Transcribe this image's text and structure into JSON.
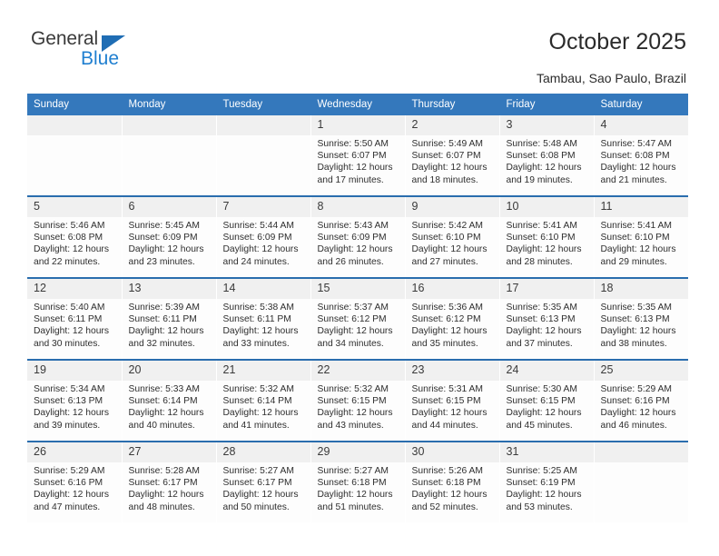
{
  "brand": {
    "name_top": "General",
    "name_bottom": "Blue",
    "logo_icon": "blue-triangle-icon",
    "accent_color": "#1f7fd0"
  },
  "header": {
    "title": "October 2025",
    "subtitle": "Tambau, Sao Paulo, Brazil"
  },
  "theme": {
    "header_row_bg": "#3478bc",
    "week_divider": "#2a6dae",
    "daynum_bg": "#f0f0f0",
    "text": "#2e2e2e"
  },
  "calendar": {
    "columns": [
      "Sunday",
      "Monday",
      "Tuesday",
      "Wednesday",
      "Thursday",
      "Friday",
      "Saturday"
    ],
    "labels": {
      "sunrise": "Sunrise:",
      "sunset": "Sunset:",
      "daylight": "Daylight:"
    },
    "weeks": [
      [
        {
          "day": "",
          "empty": true
        },
        {
          "day": "",
          "empty": true
        },
        {
          "day": "",
          "empty": true
        },
        {
          "day": "1",
          "sunrise": "5:50 AM",
          "sunset": "6:07 PM",
          "daylight": "12 hours and 17 minutes.",
          "line1": "Sunrise: 5:50 AM",
          "line2": "Sunset: 6:07 PM",
          "line3": "Daylight: 12 hours and 17 minutes."
        },
        {
          "day": "2",
          "sunrise": "5:49 AM",
          "sunset": "6:07 PM",
          "daylight": "12 hours and 18 minutes.",
          "line1": "Sunrise: 5:49 AM",
          "line2": "Sunset: 6:07 PM",
          "line3": "Daylight: 12 hours and 18 minutes."
        },
        {
          "day": "3",
          "sunrise": "5:48 AM",
          "sunset": "6:08 PM",
          "daylight": "12 hours and 19 minutes.",
          "line1": "Sunrise: 5:48 AM",
          "line2": "Sunset: 6:08 PM",
          "line3": "Daylight: 12 hours and 19 minutes."
        },
        {
          "day": "4",
          "sunrise": "5:47 AM",
          "sunset": "6:08 PM",
          "daylight": "12 hours and 21 minutes.",
          "line1": "Sunrise: 5:47 AM",
          "line2": "Sunset: 6:08 PM",
          "line3": "Daylight: 12 hours and 21 minutes."
        }
      ],
      [
        {
          "day": "5",
          "sunrise": "5:46 AM",
          "sunset": "6:08 PM",
          "daylight": "12 hours and 22 minutes.",
          "line1": "Sunrise: 5:46 AM",
          "line2": "Sunset: 6:08 PM",
          "line3": "Daylight: 12 hours and 22 minutes."
        },
        {
          "day": "6",
          "sunrise": "5:45 AM",
          "sunset": "6:09 PM",
          "daylight": "12 hours and 23 minutes.",
          "line1": "Sunrise: 5:45 AM",
          "line2": "Sunset: 6:09 PM",
          "line3": "Daylight: 12 hours and 23 minutes."
        },
        {
          "day": "7",
          "sunrise": "5:44 AM",
          "sunset": "6:09 PM",
          "daylight": "12 hours and 24 minutes.",
          "line1": "Sunrise: 5:44 AM",
          "line2": "Sunset: 6:09 PM",
          "line3": "Daylight: 12 hours and 24 minutes."
        },
        {
          "day": "8",
          "sunrise": "5:43 AM",
          "sunset": "6:09 PM",
          "daylight": "12 hours and 26 minutes.",
          "line1": "Sunrise: 5:43 AM",
          "line2": "Sunset: 6:09 PM",
          "line3": "Daylight: 12 hours and 26 minutes."
        },
        {
          "day": "9",
          "sunrise": "5:42 AM",
          "sunset": "6:10 PM",
          "daylight": "12 hours and 27 minutes.",
          "line1": "Sunrise: 5:42 AM",
          "line2": "Sunset: 6:10 PM",
          "line3": "Daylight: 12 hours and 27 minutes."
        },
        {
          "day": "10",
          "sunrise": "5:41 AM",
          "sunset": "6:10 PM",
          "daylight": "12 hours and 28 minutes.",
          "line1": "Sunrise: 5:41 AM",
          "line2": "Sunset: 6:10 PM",
          "line3": "Daylight: 12 hours and 28 minutes."
        },
        {
          "day": "11",
          "sunrise": "5:41 AM",
          "sunset": "6:10 PM",
          "daylight": "12 hours and 29 minutes.",
          "line1": "Sunrise: 5:41 AM",
          "line2": "Sunset: 6:10 PM",
          "line3": "Daylight: 12 hours and 29 minutes."
        }
      ],
      [
        {
          "day": "12",
          "sunrise": "5:40 AM",
          "sunset": "6:11 PM",
          "daylight": "12 hours and 30 minutes.",
          "line1": "Sunrise: 5:40 AM",
          "line2": "Sunset: 6:11 PM",
          "line3": "Daylight: 12 hours and 30 minutes."
        },
        {
          "day": "13",
          "sunrise": "5:39 AM",
          "sunset": "6:11 PM",
          "daylight": "12 hours and 32 minutes.",
          "line1": "Sunrise: 5:39 AM",
          "line2": "Sunset: 6:11 PM",
          "line3": "Daylight: 12 hours and 32 minutes."
        },
        {
          "day": "14",
          "sunrise": "5:38 AM",
          "sunset": "6:11 PM",
          "daylight": "12 hours and 33 minutes.",
          "line1": "Sunrise: 5:38 AM",
          "line2": "Sunset: 6:11 PM",
          "line3": "Daylight: 12 hours and 33 minutes."
        },
        {
          "day": "15",
          "sunrise": "5:37 AM",
          "sunset": "6:12 PM",
          "daylight": "12 hours and 34 minutes.",
          "line1": "Sunrise: 5:37 AM",
          "line2": "Sunset: 6:12 PM",
          "line3": "Daylight: 12 hours and 34 minutes."
        },
        {
          "day": "16",
          "sunrise": "5:36 AM",
          "sunset": "6:12 PM",
          "daylight": "12 hours and 35 minutes.",
          "line1": "Sunrise: 5:36 AM",
          "line2": "Sunset: 6:12 PM",
          "line3": "Daylight: 12 hours and 35 minutes."
        },
        {
          "day": "17",
          "sunrise": "5:35 AM",
          "sunset": "6:13 PM",
          "daylight": "12 hours and 37 minutes.",
          "line1": "Sunrise: 5:35 AM",
          "line2": "Sunset: 6:13 PM",
          "line3": "Daylight: 12 hours and 37 minutes."
        },
        {
          "day": "18",
          "sunrise": "5:35 AM",
          "sunset": "6:13 PM",
          "daylight": "12 hours and 38 minutes.",
          "line1": "Sunrise: 5:35 AM",
          "line2": "Sunset: 6:13 PM",
          "line3": "Daylight: 12 hours and 38 minutes."
        }
      ],
      [
        {
          "day": "19",
          "sunrise": "5:34 AM",
          "sunset": "6:13 PM",
          "daylight": "12 hours and 39 minutes.",
          "line1": "Sunrise: 5:34 AM",
          "line2": "Sunset: 6:13 PM",
          "line3": "Daylight: 12 hours and 39 minutes."
        },
        {
          "day": "20",
          "sunrise": "5:33 AM",
          "sunset": "6:14 PM",
          "daylight": "12 hours and 40 minutes.",
          "line1": "Sunrise: 5:33 AM",
          "line2": "Sunset: 6:14 PM",
          "line3": "Daylight: 12 hours and 40 minutes."
        },
        {
          "day": "21",
          "sunrise": "5:32 AM",
          "sunset": "6:14 PM",
          "daylight": "12 hours and 41 minutes.",
          "line1": "Sunrise: 5:32 AM",
          "line2": "Sunset: 6:14 PM",
          "line3": "Daylight: 12 hours and 41 minutes."
        },
        {
          "day": "22",
          "sunrise": "5:32 AM",
          "sunset": "6:15 PM",
          "daylight": "12 hours and 43 minutes.",
          "line1": "Sunrise: 5:32 AM",
          "line2": "Sunset: 6:15 PM",
          "line3": "Daylight: 12 hours and 43 minutes."
        },
        {
          "day": "23",
          "sunrise": "5:31 AM",
          "sunset": "6:15 PM",
          "daylight": "12 hours and 44 minutes.",
          "line1": "Sunrise: 5:31 AM",
          "line2": "Sunset: 6:15 PM",
          "line3": "Daylight: 12 hours and 44 minutes."
        },
        {
          "day": "24",
          "sunrise": "5:30 AM",
          "sunset": "6:15 PM",
          "daylight": "12 hours and 45 minutes.",
          "line1": "Sunrise: 5:30 AM",
          "line2": "Sunset: 6:15 PM",
          "line3": "Daylight: 12 hours and 45 minutes."
        },
        {
          "day": "25",
          "sunrise": "5:29 AM",
          "sunset": "6:16 PM",
          "daylight": "12 hours and 46 minutes.",
          "line1": "Sunrise: 5:29 AM",
          "line2": "Sunset: 6:16 PM",
          "line3": "Daylight: 12 hours and 46 minutes."
        }
      ],
      [
        {
          "day": "26",
          "sunrise": "5:29 AM",
          "sunset": "6:16 PM",
          "daylight": "12 hours and 47 minutes.",
          "line1": "Sunrise: 5:29 AM",
          "line2": "Sunset: 6:16 PM",
          "line3": "Daylight: 12 hours and 47 minutes."
        },
        {
          "day": "27",
          "sunrise": "5:28 AM",
          "sunset": "6:17 PM",
          "daylight": "12 hours and 48 minutes.",
          "line1": "Sunrise: 5:28 AM",
          "line2": "Sunset: 6:17 PM",
          "line3": "Daylight: 12 hours and 48 minutes."
        },
        {
          "day": "28",
          "sunrise": "5:27 AM",
          "sunset": "6:17 PM",
          "daylight": "12 hours and 50 minutes.",
          "line1": "Sunrise: 5:27 AM",
          "line2": "Sunset: 6:17 PM",
          "line3": "Daylight: 12 hours and 50 minutes."
        },
        {
          "day": "29",
          "sunrise": "5:27 AM",
          "sunset": "6:18 PM",
          "daylight": "12 hours and 51 minutes.",
          "line1": "Sunrise: 5:27 AM",
          "line2": "Sunset: 6:18 PM",
          "line3": "Daylight: 12 hours and 51 minutes."
        },
        {
          "day": "30",
          "sunrise": "5:26 AM",
          "sunset": "6:18 PM",
          "daylight": "12 hours and 52 minutes.",
          "line1": "Sunrise: 5:26 AM",
          "line2": "Sunset: 6:18 PM",
          "line3": "Daylight: 12 hours and 52 minutes."
        },
        {
          "day": "31",
          "sunrise": "5:25 AM",
          "sunset": "6:19 PM",
          "daylight": "12 hours and 53 minutes.",
          "line1": "Sunrise: 5:25 AM",
          "line2": "Sunset: 6:19 PM",
          "line3": "Daylight: 12 hours and 53 minutes."
        },
        {
          "day": "",
          "empty": true
        }
      ]
    ]
  }
}
